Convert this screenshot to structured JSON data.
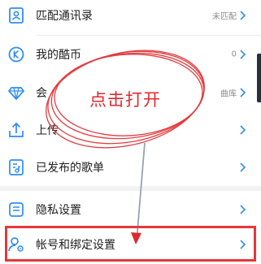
{
  "menu": {
    "items": [
      {
        "label": "匹配通讯录",
        "value": "未匹配",
        "icon": "contact-card-icon"
      },
      {
        "label": "我的酷币",
        "value": "0",
        "icon": "coin-icon"
      },
      {
        "label": "会",
        "value": "曲库",
        "icon": "diamond-icon"
      },
      {
        "label": "上传",
        "value": "",
        "icon": "upload-icon"
      },
      {
        "label": "已发布的歌单",
        "value": "",
        "icon": "playlist-icon"
      },
      {
        "label": "隐私设置",
        "value": "",
        "icon": "privacy-shield-icon"
      },
      {
        "label": "帐号和绑定设置",
        "value": "",
        "icon": "account-settings-icon"
      }
    ]
  },
  "annotation": {
    "text": "点击打开",
    "color": "#e0292d"
  },
  "colors": {
    "accent": "#2f8cf5",
    "annotation_red": "#e8373a",
    "text": "#222222",
    "secondary_text": "#8c8c8c"
  }
}
